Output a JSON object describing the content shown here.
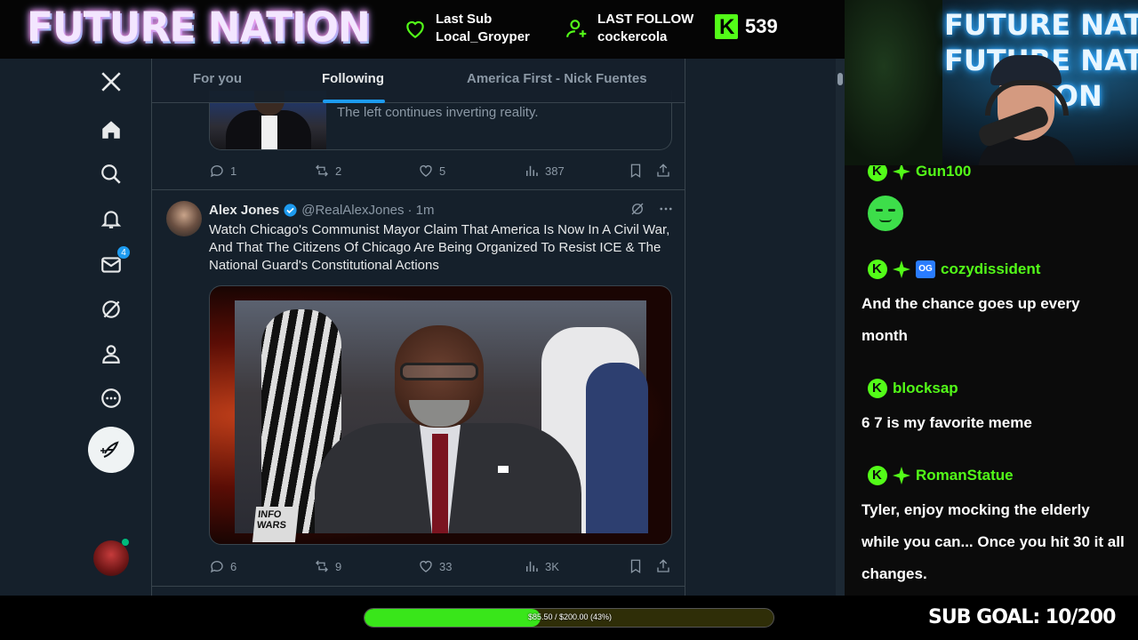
{
  "overlay": {
    "brand": "FUTURE NATION",
    "last_sub_label": "Last Sub",
    "last_sub_name": "Local_Groyper",
    "last_follow_label": "LAST FOLLOW",
    "last_follow_name": "cockercola",
    "kick_count": "539",
    "goal_text": "$85.50 / $200.00 (43%)",
    "goal_fraction": 0.43,
    "sub_goal": "SUB GOAL: 10/200",
    "cam_sign_lines": [
      "FUTURE NATION",
      "FUTURE NATION",
      "TION"
    ]
  },
  "tabs": [
    "For you",
    "Following",
    "America First - Nick Fuentes"
  ],
  "quoted": {
    "text": "The left continues inverting reality."
  },
  "tweet1_stats": {
    "replies": "1",
    "reposts": "2",
    "likes": "5",
    "views": "387"
  },
  "tweet2": {
    "name": "Alex Jones",
    "handle": "@RealAlexJones",
    "time": "· 1m",
    "text": "Watch Chicago's Communist Mayor Claim That America Is Now In A Civil War, And That The Citizens Of Chicago Are Being Organized To Resist ICE & The National Guard's Constitutional Actions",
    "media_logo": "INFO WARS",
    "stats": {
      "replies": "6",
      "reposts": "9",
      "likes": "33",
      "views": "3K"
    }
  },
  "nav": {
    "messages_badge": "4"
  },
  "chat": [
    {
      "user": "Gun100",
      "text": ""
    },
    {
      "user": "cozydissident",
      "text": "And the chance goes up every month"
    },
    {
      "user": "blocksap",
      "text": "6 7 is my favorite meme"
    },
    {
      "user": "RomanStatue",
      "text": "Tyler, enjoy mocking the elderly while you can... Once you hit 30 it all changes."
    }
  ],
  "colors": {
    "kick_green": "#53fc18",
    "twitter_bg": "#15202b",
    "accent_blue": "#1d9bf0"
  }
}
